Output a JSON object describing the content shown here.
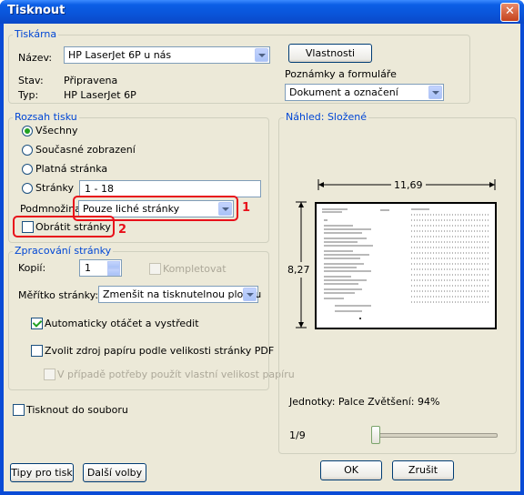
{
  "window": {
    "title": "Tisknout",
    "close_symbol": "✕"
  },
  "printer": {
    "legend": "Tiskárna",
    "name_label": "Název:",
    "name_value": "HP LaserJet 6P u nás",
    "properties_button": "Vlastnosti",
    "status_label": "Stav:",
    "status_value": "Připravena",
    "type_label": "Typ:",
    "type_value": "HP LaserJet 6P",
    "notes_label": "Poznámky a formuláře",
    "notes_value": "Dokument a označení"
  },
  "range": {
    "legend": "Rozsah tisku",
    "options": [
      "Všechny",
      "Současné zobrazení",
      "Platná stránka",
      "Stránky"
    ],
    "selected": "Všechny",
    "pages_value": "1 - 18",
    "subset_label": "Podmnožina:",
    "subset_value": "Pouze liché stránky",
    "reverse_label": "Obrátit stránky",
    "annotation_1": "1",
    "annotation_2": "2"
  },
  "handling": {
    "legend": "Zpracování stránky",
    "copies_label": "Kopií:",
    "copies_value": "1",
    "collate_label": "Kompletovat",
    "scaling_label": "Měřítko stránky:",
    "scaling_value": "Zmenšit na tisknutelnou plochu",
    "auto_rotate_label": "Automaticky otáčet a vystředit",
    "auto_rotate_checked": true,
    "paper_source_label": "Zvolit zdroj papíru podle velikosti stránky PDF",
    "custom_size_label": "V případě potřeby použít vlastní velikost papíru"
  },
  "print_to_file_label": "Tisknout do souboru",
  "preview": {
    "legend": "Náhled: Složené",
    "width_label": "11,69",
    "height_label": "8,27",
    "units_text": "Jednotky: Palce Zvětšení:  94%",
    "page_counter": "1/9",
    "slider_position": 0.0
  },
  "buttons": {
    "tips": "Tipy pro tisk",
    "more": "Další volby",
    "ok": "OK",
    "cancel": "Zrušit"
  }
}
